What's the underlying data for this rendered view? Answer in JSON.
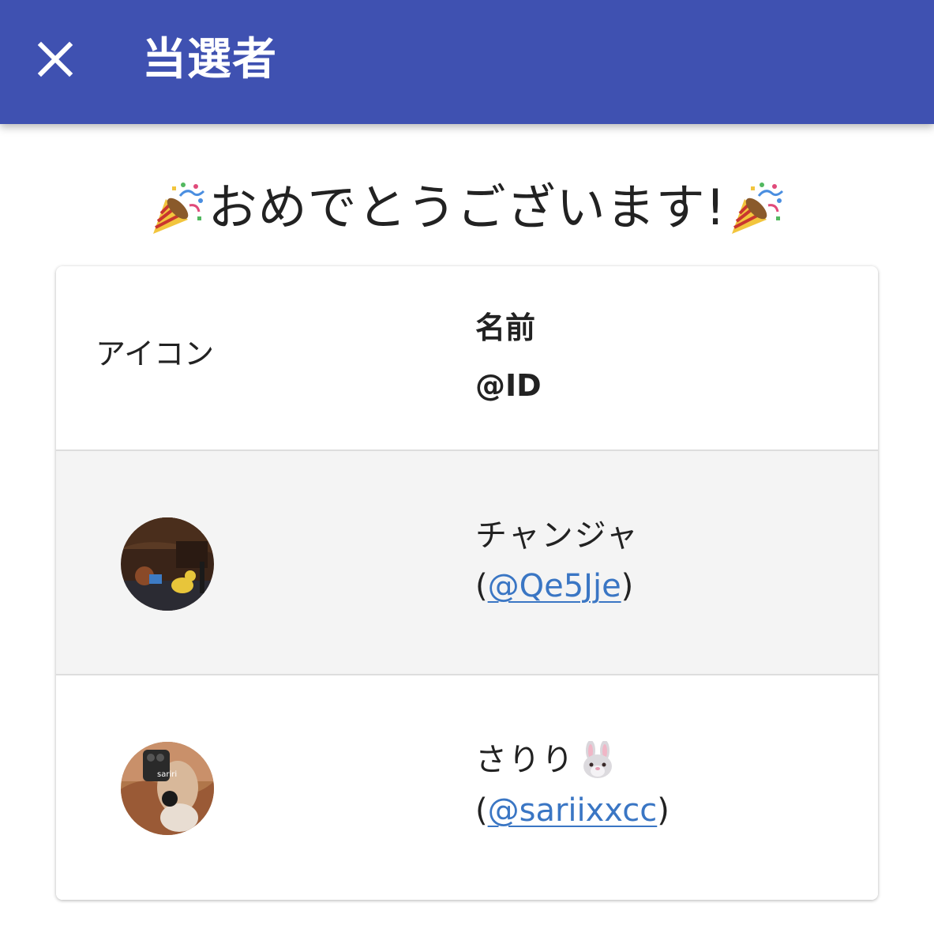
{
  "appbar": {
    "title": "当選者",
    "close_icon": "close-icon",
    "background": "#3f51b1"
  },
  "headline": {
    "text": "おめでとうございます!",
    "icon": "party-popper-icon"
  },
  "table": {
    "headers": {
      "icon": "アイコン",
      "name": "名前",
      "id": "@ID"
    },
    "rows": [
      {
        "name": "チャンジャ",
        "name_icon": "",
        "open_paren": "(",
        "handle": "@Qe5Jje",
        "close_paren": ")",
        "avatar": "avatar-cartoon"
      },
      {
        "name": "さりり",
        "name_icon": "rabbit-face-icon",
        "open_paren": "(",
        "handle": "@sariixxcc",
        "close_paren": ")",
        "avatar": "avatar-photo"
      }
    ]
  },
  "colors": {
    "link": "#3a76c4",
    "row_shaded": "#f4f4f4"
  }
}
